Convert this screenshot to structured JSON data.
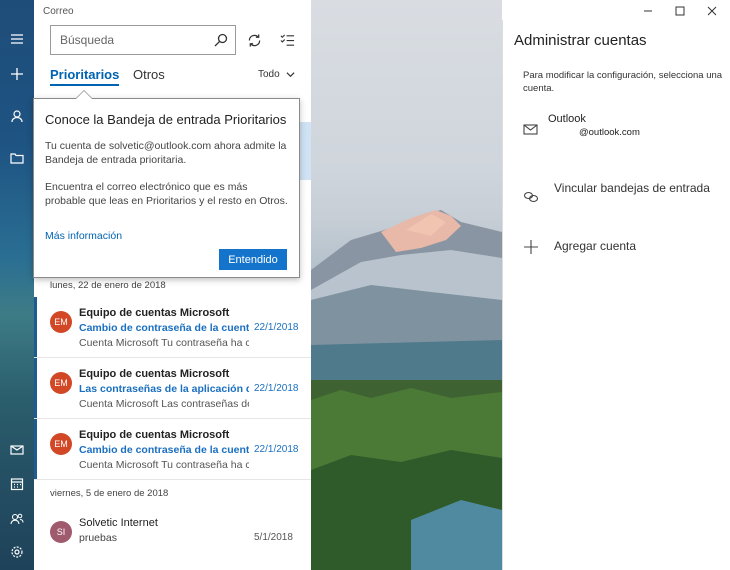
{
  "app": {
    "name": "Correo"
  },
  "search": {
    "placeholder": "Búsqueda"
  },
  "tabs": [
    {
      "label": "Prioritarios"
    },
    {
      "label": "Otros"
    }
  ],
  "filter": {
    "label": "Todo"
  },
  "callout": {
    "title": "Conoce la Bandeja de entrada Prioritarios",
    "para1": "Tu cuenta de solvetic@outlook.com ahora admite la Bandeja de entrada prioritaria.",
    "para2": "Encuentra el correo electrónico que es más probable que leas en Prioritarios y el resto en Otros.",
    "link": "Más información",
    "button": "Entendido"
  },
  "groups": [
    {
      "date": "lunes, 22 de enero de 2018"
    },
    {
      "date": "viernes, 5 de enero de 2018"
    }
  ],
  "messages": [
    {
      "initials": "EM",
      "color": "#d24726",
      "sender": "Equipo de cuentas Microsoft",
      "subject": "Cambio de contraseña de la cuenta",
      "date": "22/1/2018",
      "preview": "Cuenta Microsoft Tu contraseña ha cambiado"
    },
    {
      "initials": "EM",
      "color": "#d24726",
      "sender": "Equipo de cuentas Microsoft",
      "subject": "Las contraseñas de la aplicación de",
      "date": "22/1/2018",
      "preview": "Cuenta Microsoft Las contraseñas de la"
    },
    {
      "initials": "EM",
      "color": "#d24726",
      "sender": "Equipo de cuentas Microsoft",
      "subject": "Cambio de contraseña de la cuenta",
      "date": "22/1/2018",
      "preview": "Cuenta Microsoft Tu contraseña ha cambiado"
    },
    {
      "initials": "SI",
      "color": "#a05a6e",
      "sender": "Solvetic Internet",
      "subject": "pruebas",
      "date": "5/1/2018",
      "preview": ""
    }
  ],
  "accounts": {
    "title": "Administrar cuentas",
    "hint": "Para modificar la configuración, selecciona una cuenta.",
    "account_name": "Outlook",
    "account_email": "@outlook.com",
    "link_inboxes": "Vincular bandejas de entrada",
    "add_account": "Agregar cuenta"
  }
}
